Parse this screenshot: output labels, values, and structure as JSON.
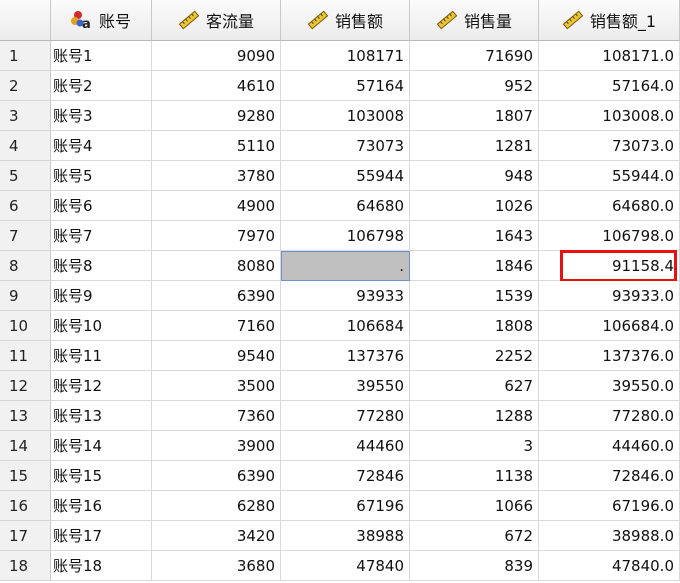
{
  "columns": [
    {
      "label": "账号",
      "icon": "string-variable-icon"
    },
    {
      "label": "客流量",
      "icon": "scale-ruler-icon"
    },
    {
      "label": "销售额",
      "icon": "scale-ruler-icon"
    },
    {
      "label": "销售量",
      "icon": "scale-ruler-icon"
    },
    {
      "label": "销售额_1",
      "icon": "scale-ruler-icon"
    }
  ],
  "rows": [
    {
      "n": "1",
      "account": "账号1",
      "traffic": "9090",
      "sales": "108171",
      "volume": "71690",
      "sales1": "108171.0"
    },
    {
      "n": "2",
      "account": "账号2",
      "traffic": "4610",
      "sales": "57164",
      "volume": "952",
      "sales1": "57164.0"
    },
    {
      "n": "3",
      "account": "账号3",
      "traffic": "9280",
      "sales": "103008",
      "volume": "1807",
      "sales1": "103008.0"
    },
    {
      "n": "4",
      "account": "账号4",
      "traffic": "5110",
      "sales": "73073",
      "volume": "1281",
      "sales1": "73073.0"
    },
    {
      "n": "5",
      "account": "账号5",
      "traffic": "3780",
      "sales": "55944",
      "volume": "948",
      "sales1": "55944.0"
    },
    {
      "n": "6",
      "account": "账号6",
      "traffic": "4900",
      "sales": "64680",
      "volume": "1026",
      "sales1": "64680.0"
    },
    {
      "n": "7",
      "account": "账号7",
      "traffic": "7970",
      "sales": "106798",
      "volume": "1643",
      "sales1": "106798.0"
    },
    {
      "n": "8",
      "account": "账号8",
      "traffic": "8080",
      "sales": ".",
      "volume": "1846",
      "sales1": "91158.4"
    },
    {
      "n": "9",
      "account": "账号9",
      "traffic": "6390",
      "sales": "93933",
      "volume": "1539",
      "sales1": "93933.0"
    },
    {
      "n": "10",
      "account": "账号10",
      "traffic": "7160",
      "sales": "106684",
      "volume": "1808",
      "sales1": "106684.0"
    },
    {
      "n": "11",
      "account": "账号11",
      "traffic": "9540",
      "sales": "137376",
      "volume": "2252",
      "sales1": "137376.0"
    },
    {
      "n": "12",
      "account": "账号12",
      "traffic": "3500",
      "sales": "39550",
      "volume": "627",
      "sales1": "39550.0"
    },
    {
      "n": "13",
      "account": "账号13",
      "traffic": "7360",
      "sales": "77280",
      "volume": "1288",
      "sales1": "77280.0"
    },
    {
      "n": "14",
      "account": "账号14",
      "traffic": "3900",
      "sales": "44460",
      "volume": "3",
      "sales1": "44460.0"
    },
    {
      "n": "15",
      "account": "账号15",
      "traffic": "6390",
      "sales": "72846",
      "volume": "1138",
      "sales1": "72846.0"
    },
    {
      "n": "16",
      "account": "账号16",
      "traffic": "6280",
      "sales": "67196",
      "volume": "1066",
      "sales1": "67196.0"
    },
    {
      "n": "17",
      "account": "账号17",
      "traffic": "3420",
      "sales": "38988",
      "volume": "672",
      "sales1": "38988.0"
    },
    {
      "n": "18",
      "account": "账号18",
      "traffic": "3680",
      "sales": "47840",
      "volume": "839",
      "sales1": "47840.0"
    }
  ],
  "selected_cell": {
    "row": "8",
    "column": "销售额"
  },
  "highlighted_cell": {
    "row": "8",
    "column": "销售额_1"
  },
  "colors": {
    "highlight_border": "#e81010",
    "selected_fill": "#c0c0c0"
  }
}
